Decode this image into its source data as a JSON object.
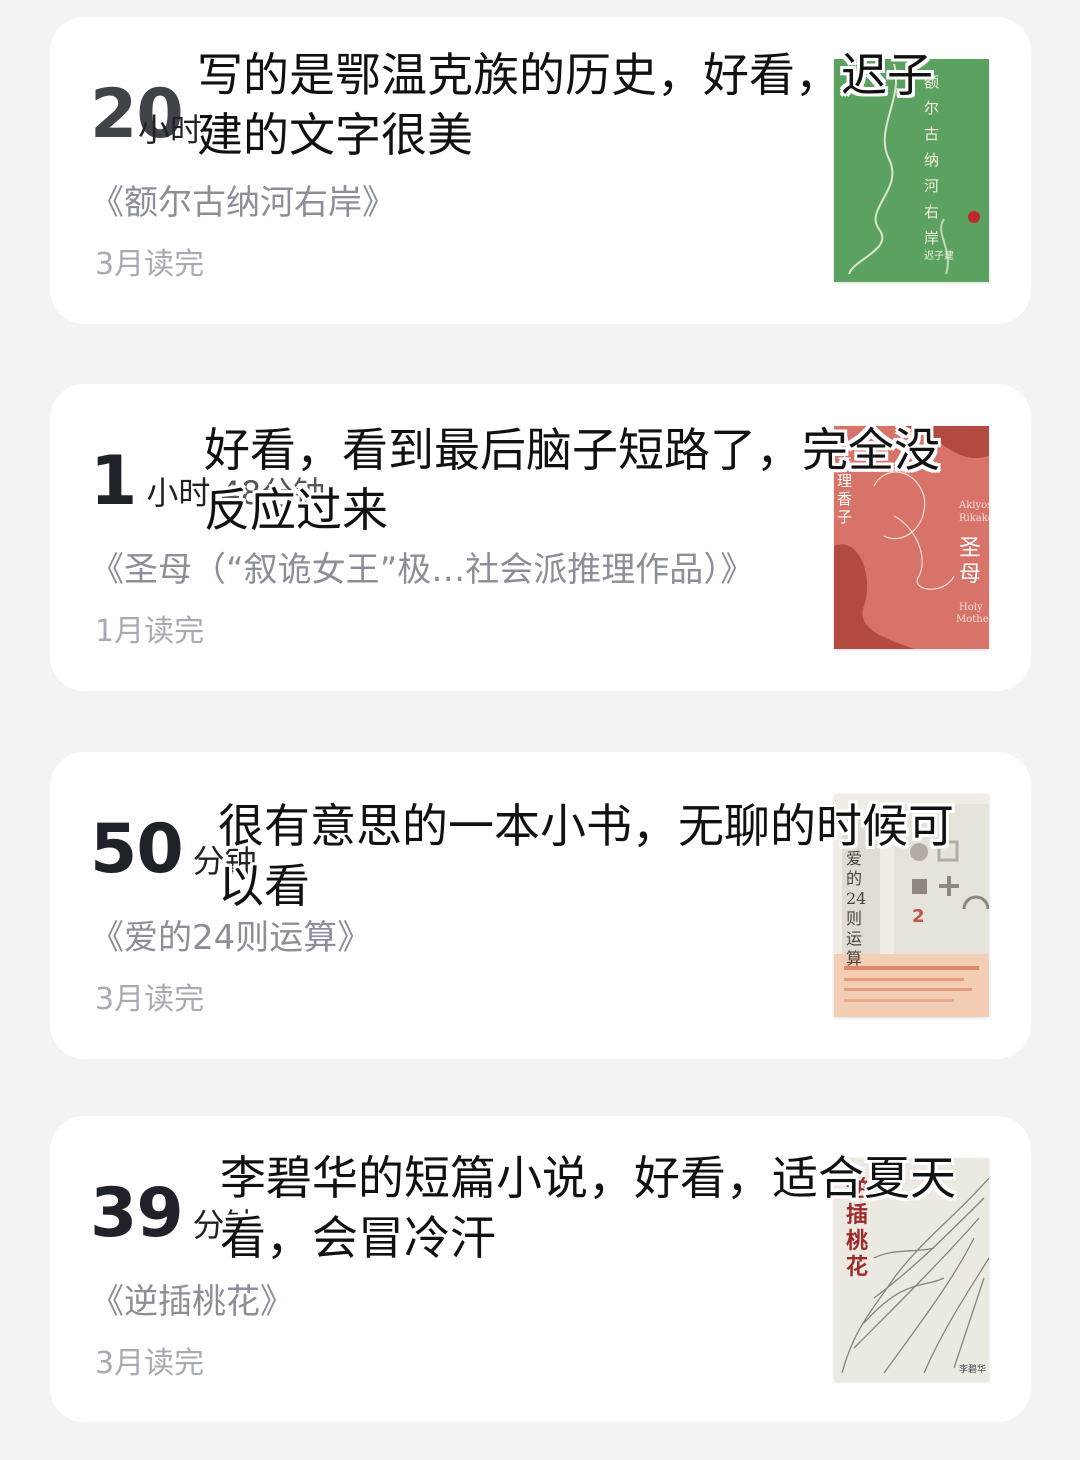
{
  "cards": [
    {
      "duration_num": "20",
      "duration_unit": "小时",
      "duration_unit2": "",
      "book_title": "《额尔古纳河右岸》",
      "finished": "3月读完",
      "overlay_line1": "写的是鄂温克族的历史，好看，迟子",
      "overlay_line2": "建的文字很美",
      "cover_text": "额尔古纳河右岸",
      "cover_author": "迟子建",
      "cover_color": "#5ba15f"
    },
    {
      "duration_num": "1",
      "duration_unit": "小时",
      "duration_unit2": "48分钟",
      "book_title": "《圣母（“叙诡女王”极…社会派推理作品）》",
      "finished": "1月读完",
      "overlay_line1": "好看，看到最后脑子短路了，完全没",
      "overlay_line2": "反应过来",
      "cover_text": "圣母",
      "cover_author": "秋吉理香子",
      "cover_sub1": "Akiyoshi",
      "cover_sub2": "Rikako",
      "cover_sub3": "Holy",
      "cover_sub4": "Mother",
      "cover_color": "#d8736a"
    },
    {
      "duration_num": "50",
      "duration_unit": "分钟",
      "duration_unit2": "",
      "book_title": "《爱的24则运算》",
      "finished": "3月读完",
      "overlay_line1": "很有意思的一本小书，无聊的时候可",
      "overlay_line2": "以看",
      "cover_text": "爱的24则运算",
      "cover_color": "#f1ece4"
    },
    {
      "duration_num": "39",
      "duration_unit": "分钟",
      "duration_unit2": "",
      "book_title": "《逆插桃花》",
      "finished": "3月读完",
      "overlay_line1": "李碧华的短篇小说，好看，适合夏天",
      "overlay_line2": "看，会冒冷汗",
      "cover_text": "逆插桃花",
      "cover_author": "李碧华",
      "cover_color": "#ece8e2"
    }
  ]
}
